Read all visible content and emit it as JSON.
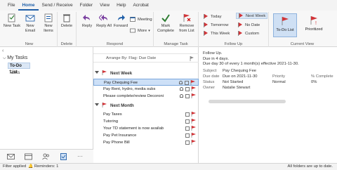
{
  "tabs": [
    "File",
    "Home",
    "Send / Receive",
    "Folder",
    "View",
    "Help",
    "Acrobat"
  ],
  "ribbon": {
    "new": {
      "label": "New",
      "new_task": "New Task",
      "new_email": "New Email",
      "new_items": "New Items"
    },
    "delete": {
      "label": "Delete",
      "delete_btn": "Delete"
    },
    "respond": {
      "label": "Respond",
      "reply": "Reply",
      "reply_all": "Reply All",
      "forward": "Forward",
      "meeting": "Meeting",
      "more": "More"
    },
    "manage": {
      "label": "Manage Task",
      "mark_complete": "Mark Complete",
      "remove": "Remove from List"
    },
    "followup": {
      "label": "Follow Up",
      "today": "Today",
      "tomorrow": "Tomorrow",
      "this_week": "This Week",
      "next_week": "Next Week",
      "no_date": "No Date",
      "custom": "Custom"
    },
    "view": {
      "label": "Current View",
      "todo": "To-Do List",
      "prioritized": "Prioritized"
    }
  },
  "nav": {
    "my_tasks": "My Tasks",
    "todo_list": "To-Do List",
    "tasks": "Tasks"
  },
  "list": {
    "column_header": "Arrange By: Flag: Due Date",
    "groups": [
      {
        "label": "Next Week",
        "rows": [
          "Pay Chequing Fee",
          "Pay Rent, hydro, media subs",
          "Please complete/review Decoronizing ..."
        ]
      },
      {
        "label": "Next Month",
        "rows": [
          "Pay Taxes",
          "Tutoring",
          "Your TD statement is now available",
          "Pay Pet Insurance",
          "Pay Phone Bill"
        ]
      }
    ]
  },
  "reading": {
    "followup": "Follow Up.",
    "due_in": "Due in 4 days.",
    "recurrence": "Due day 30 of every 1 month(s) effective 2021-11-30.",
    "subject_label": "Subject",
    "subject_value": "Pay Chequing Fee",
    "due_label": "Due date",
    "due_value": "Due on 2021-11-30",
    "status_label": "Status",
    "status_value": "Not Started",
    "priority_label": "Priority",
    "priority_value": "Normal",
    "pct_label": "% Complete",
    "pct_value": "0%",
    "owner_label": "Owner",
    "owner_value": "Natalie Stewart"
  },
  "status": {
    "filter": "Filter applied",
    "reminders": "Reminders: 1",
    "right": "All folders are up to date."
  },
  "colors": {
    "accent": "#1f5fa8",
    "flag": "#d13438",
    "selected": "#cde0f7"
  }
}
